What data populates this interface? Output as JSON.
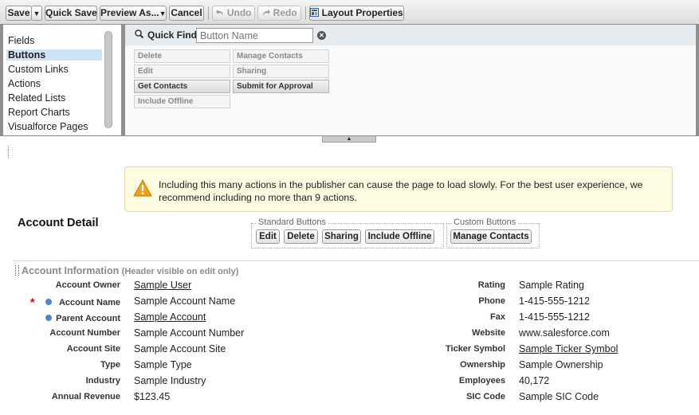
{
  "toolbar": {
    "save": "Save",
    "quick_save": "Quick Save",
    "preview_as": "Preview As...",
    "cancel": "Cancel",
    "undo": "Undo",
    "redo": "Redo",
    "layout_properties": "Layout Properties"
  },
  "palette": {
    "categories": [
      "Fields",
      "Buttons",
      "Custom Links",
      "Actions",
      "Related Lists",
      "Report Charts",
      "Visualforce Pages"
    ],
    "active_category": "Buttons",
    "quick_find_label": "Quick Find",
    "quick_find_placeholder": "Button Name",
    "tiles": [
      {
        "label": "Delete",
        "used": false
      },
      {
        "label": "Manage Contacts",
        "used": false
      },
      {
        "label": "Edit",
        "used": false
      },
      {
        "label": "Sharing",
        "used": false
      },
      {
        "label": "Get Contacts",
        "used": true
      },
      {
        "label": "Submit for Approval",
        "used": true
      },
      {
        "label": "Include Offline",
        "used": false
      }
    ]
  },
  "warning": {
    "text": "Including this many actions in the publisher can cause the page to load slowly. For the best user experience, we recommend including no more than 9 actions."
  },
  "detail": {
    "title": "Account Detail",
    "standard_buttons_label": "Standard Buttons",
    "standard_buttons": [
      "Edit",
      "Delete",
      "Sharing",
      "Include Offline"
    ],
    "custom_buttons_label": "Custom Buttons",
    "custom_buttons": [
      "Manage Contacts"
    ]
  },
  "section": {
    "title": "Account Information",
    "subtitle": "(Header visible on edit only)",
    "left_fields": [
      {
        "label": "Account Owner",
        "value": "Sample User",
        "link": true
      },
      {
        "label": "Account Name",
        "value": "Sample Account Name",
        "link": false,
        "required": true,
        "dot": true
      },
      {
        "label": "Parent Account",
        "value": "Sample Account",
        "link": true,
        "dot": true
      },
      {
        "label": "Account Number",
        "value": "Sample Account Number",
        "link": false
      },
      {
        "label": "Account Site",
        "value": "Sample Account Site",
        "link": false
      },
      {
        "label": "Type",
        "value": "Sample Type",
        "link": false
      },
      {
        "label": "Industry",
        "value": "Sample Industry",
        "link": false
      },
      {
        "label": "Annual Revenue",
        "value": "$123.45",
        "link": false
      }
    ],
    "right_fields": [
      {
        "label": "Rating",
        "value": "Sample Rating",
        "link": false
      },
      {
        "label": "Phone",
        "value": "1-415-555-1212",
        "link": false
      },
      {
        "label": "Fax",
        "value": "1-415-555-1212",
        "link": false
      },
      {
        "label": "Website",
        "value": "www.salesforce.com",
        "link": false
      },
      {
        "label": "Ticker Symbol",
        "value": "Sample Ticker Symbol",
        "link": true
      },
      {
        "label": "Ownership",
        "value": "Sample Ownership",
        "link": false
      },
      {
        "label": "Employees",
        "value": "40,172",
        "link": false
      },
      {
        "label": "SIC Code",
        "value": "Sample SIC Code",
        "link": false
      }
    ]
  },
  "colors": {
    "active_category_bg": "#cfe3f6",
    "warning_bg": "#fefce0",
    "required_star": "#cc0000",
    "field_dot": "#4a86d8",
    "palette_frame": "#8f8f8f"
  },
  "icons": [
    "undo-icon",
    "redo-icon",
    "layout-properties-icon",
    "search-icon",
    "clear-icon",
    "warning-icon",
    "collapse-arrow-icon"
  ]
}
